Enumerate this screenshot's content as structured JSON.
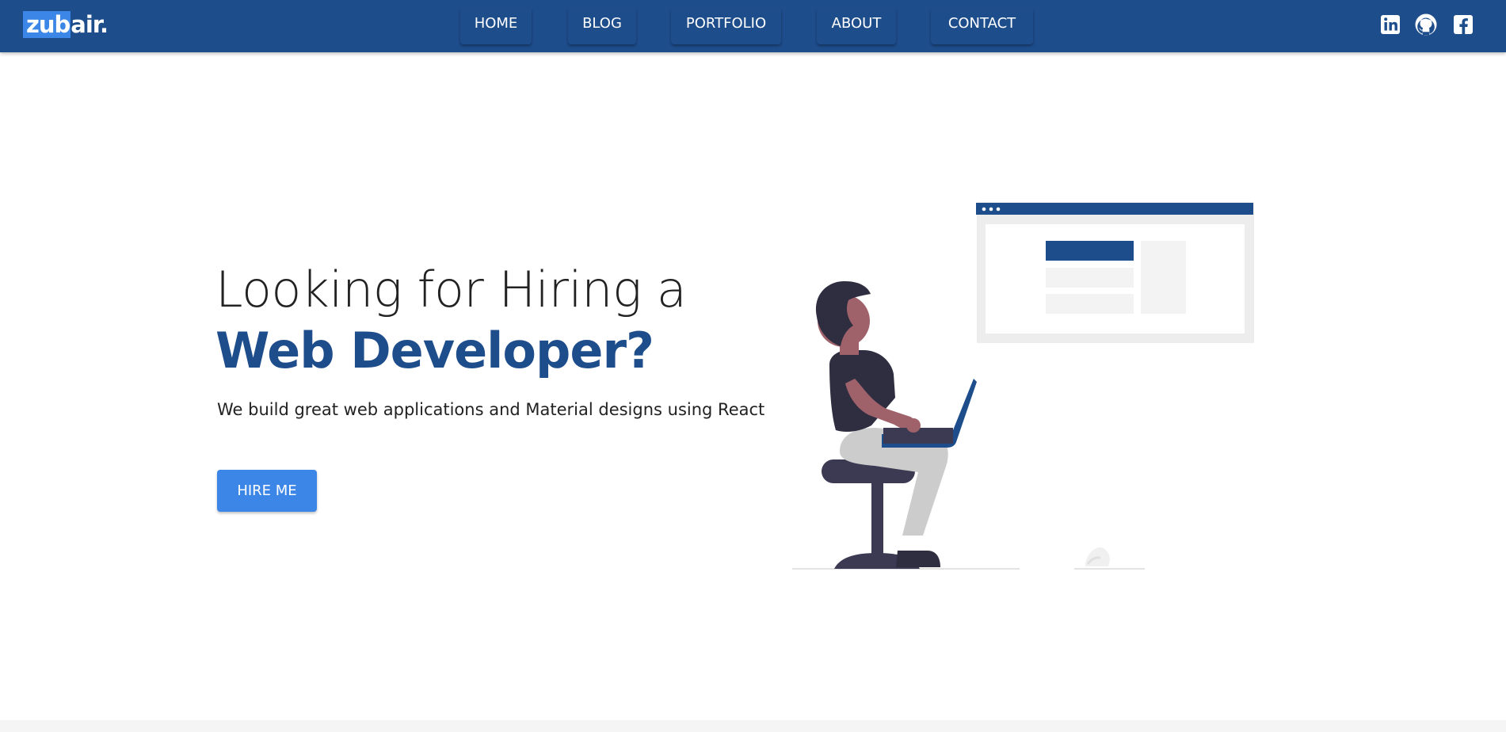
{
  "brand": {
    "logo_highlight": "zub",
    "logo_rest": "air."
  },
  "nav": {
    "items": [
      {
        "label": "HOME"
      },
      {
        "label": "BLOG"
      },
      {
        "label": "PORTFOLIO"
      },
      {
        "label": "ABOUT"
      },
      {
        "label": "CONTACT"
      }
    ]
  },
  "social": {
    "icons": [
      "linkedin-icon",
      "github-icon",
      "facebook-icon"
    ]
  },
  "hero": {
    "title_line1": "Looking for Hiring a",
    "title_line2": "Web Developer?",
    "description": "We build great web applications and Material designs using React",
    "button_label": "HIRE ME"
  },
  "colors": {
    "primary": "#1e4d8c",
    "accent": "#3b86e6",
    "text": "#222222",
    "background": "#ffffff"
  }
}
